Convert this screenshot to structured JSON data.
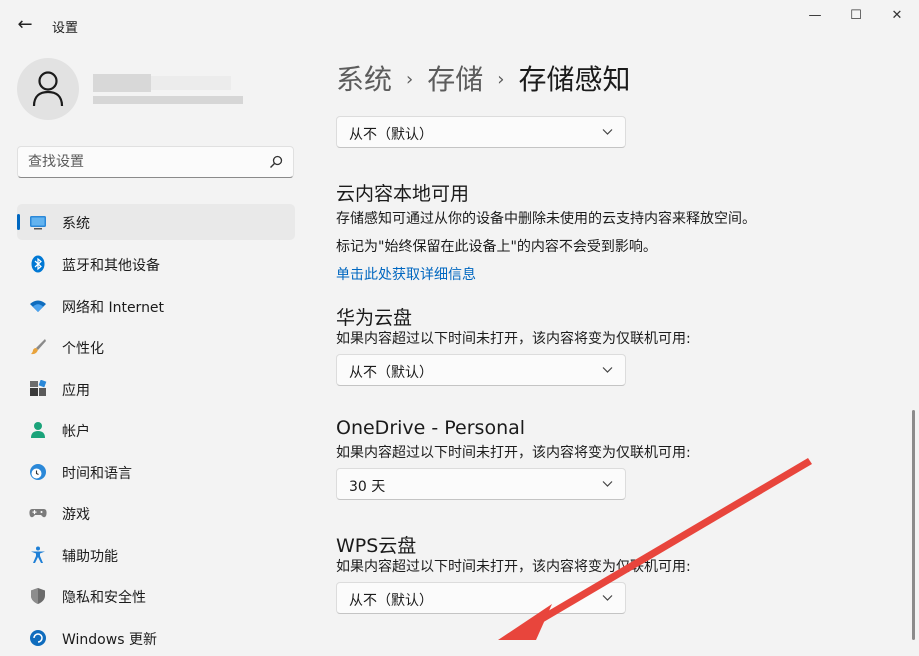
{
  "window": {
    "title": "设置",
    "back_glyph": "←",
    "min_glyph": "—",
    "max_glyph": "☐",
    "close_glyph": "✕"
  },
  "search": {
    "placeholder": "查找设置",
    "value": ""
  },
  "sidebar": {
    "items": [
      {
        "label": "系统",
        "icon": "system-icon",
        "selected": true
      },
      {
        "label": "蓝牙和其他设备",
        "icon": "bluetooth-icon"
      },
      {
        "label": "网络和 Internet",
        "icon": "wifi-icon"
      },
      {
        "label": "个性化",
        "icon": "brush-icon"
      },
      {
        "label": "应用",
        "icon": "apps-icon"
      },
      {
        "label": "帐户",
        "icon": "account-icon"
      },
      {
        "label": "时间和语言",
        "icon": "clock-globe-icon"
      },
      {
        "label": "游戏",
        "icon": "gamepad-icon"
      },
      {
        "label": "辅助功能",
        "icon": "accessibility-icon"
      },
      {
        "label": "隐私和安全性",
        "icon": "shield-icon"
      },
      {
        "label": "Windows 更新",
        "icon": "update-icon"
      }
    ]
  },
  "breadcrumb": {
    "items": [
      "系统",
      "存储"
    ],
    "separator": "›",
    "current": "存储感知"
  },
  "content": {
    "top_dropdown": "从不（默认）",
    "cloud": {
      "title": "云内容本地可用",
      "line1": "存储感知可通过从你的设备中删除未使用的云支持内容来释放空间。",
      "line2": "标记为\"始终保留在此设备上\"的内容不会受到影响。",
      "link": "单击此处获取详细信息"
    },
    "providers": [
      {
        "title": "华为云盘",
        "desc": "如果内容超过以下时间未打开，该内容将变为仅联机可用:",
        "dropdown": "从不（默认）"
      },
      {
        "title": "OneDrive - Personal",
        "desc": "如果内容超过以下时间未打开，该内容将变为仅联机可用:",
        "dropdown": "30 天"
      },
      {
        "title": "WPS云盘",
        "desc": "如果内容超过以下时间未打开，该内容将变为仅联机可用:",
        "dropdown": "从不（默认）"
      }
    ]
  },
  "colors": {
    "accent": "#0067c0",
    "annotation_arrow": "#e8453c",
    "background": "#f3f3f3"
  }
}
